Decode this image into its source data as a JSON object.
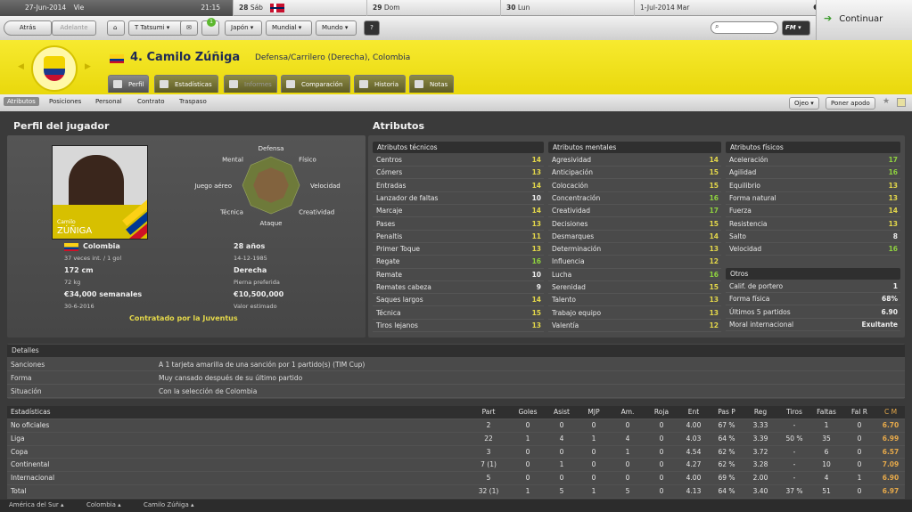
{
  "calendar": {
    "cells": [
      {
        "date": "27-Jun-2014",
        "day": "Vie",
        "time": "21:15"
      },
      {
        "date": "28",
        "day": "Sáb"
      },
      {
        "date": "29",
        "day": "Dom"
      },
      {
        "date": "30",
        "day": "Lun"
      },
      {
        "date": "1-Jul-2014",
        "day": "Mar"
      }
    ]
  },
  "toolbar": {
    "back": "Atrás",
    "forward": "Adelante",
    "manager": "T Tatsumi",
    "notif_count": "1",
    "menus": [
      "Japón",
      "Mundial",
      "Mundo"
    ],
    "help": "?",
    "fm": "FM",
    "continue": "Continuar"
  },
  "player": {
    "title": "4. Camilo Zúñiga",
    "position": "Defensa/Carrilero (Derecha), Colombia",
    "photo_caption_small": "Camilo",
    "photo_caption_big": "ZÚÑIGA",
    "nation": "Colombia",
    "caps": "37 veces int. / 1 gol",
    "age": "28 años",
    "dob": "14-12-1985",
    "height": "172 cm",
    "weight": "72 kg",
    "foot": "Derecha",
    "foot_label": "Pierna preferida",
    "wage": "€34,000 semanales",
    "contract_end": "30-6-2016",
    "value": "€10,500,000",
    "value_label": "Valor estimado",
    "contract_note": "Contratado por la Juventus"
  },
  "tabs": [
    "Perfil",
    "Estadísticas",
    "Informes",
    "Comparación",
    "Historia",
    "Notas"
  ],
  "subnav": {
    "items": [
      "Atributos",
      "Posiciones",
      "Personal",
      "Contrato",
      "Traspaso"
    ],
    "scout": "Ojeo",
    "ponder": "Poner apodo"
  },
  "sections": {
    "profile": "Perfil del jugador",
    "attributes": "Atributos"
  },
  "radar": {
    "labels": [
      "Defensa",
      "Físico",
      "Velocidad",
      "Creatividad",
      "Ataque",
      "Técnica",
      "Juego aéreo",
      "Mental"
    ]
  },
  "technical": {
    "title": "Atributos técnicos",
    "rows": [
      [
        "Centros",
        "14"
      ],
      [
        "Córners",
        "13"
      ],
      [
        "Entradas",
        "14"
      ],
      [
        "Lanzador de faltas",
        "10"
      ],
      [
        "Marcaje",
        "14"
      ],
      [
        "Pases",
        "13"
      ],
      [
        "Penaltis",
        "11"
      ],
      [
        "Primer Toque",
        "13"
      ],
      [
        "Regate",
        "16"
      ],
      [
        "Remate",
        "10"
      ],
      [
        "Remates cabeza",
        "9"
      ],
      [
        "Saques largos",
        "14"
      ],
      [
        "Técnica",
        "15"
      ],
      [
        "Tiros lejanos",
        "13"
      ]
    ]
  },
  "mental": {
    "title": "Atributos mentales",
    "rows": [
      [
        "Agresividad",
        "14"
      ],
      [
        "Anticipación",
        "15"
      ],
      [
        "Colocación",
        "15"
      ],
      [
        "Concentración",
        "16"
      ],
      [
        "Creatividad",
        "17"
      ],
      [
        "Decisiones",
        "15"
      ],
      [
        "Desmarques",
        "14"
      ],
      [
        "Determinación",
        "13"
      ],
      [
        "Influencia",
        "12"
      ],
      [
        "Lucha",
        "16"
      ],
      [
        "Serenidad",
        "15"
      ],
      [
        "Talento",
        "13"
      ],
      [
        "Trabajo equipo",
        "13"
      ],
      [
        "Valentía",
        "12"
      ]
    ]
  },
  "physical": {
    "title": "Atributos físicos",
    "rows": [
      [
        "Aceleración",
        "17"
      ],
      [
        "Agilidad",
        "16"
      ],
      [
        "Equilibrio",
        "13"
      ],
      [
        "Forma natural",
        "13"
      ],
      [
        "Fuerza",
        "14"
      ],
      [
        "Resistencia",
        "13"
      ],
      [
        "Salto",
        "8"
      ],
      [
        "Velocidad",
        "16"
      ]
    ]
  },
  "others": {
    "title": "Otros",
    "rows": [
      [
        "Calif. de portero",
        "1"
      ],
      [
        "Forma física",
        "68%"
      ],
      [
        "Últimos 5 partidos",
        "6.90"
      ],
      [
        "Moral internacional",
        "Exultante"
      ]
    ]
  },
  "details": {
    "title": "Detalles",
    "rows": [
      [
        "Sanciones",
        "A 1 tarjeta amarilla de una sanción por 1 partido(s) (TIM Cup)"
      ],
      [
        "Forma",
        "Muy cansado después de su último partido"
      ],
      [
        "Situación",
        "Con la selección de Colombia"
      ]
    ]
  },
  "stats": {
    "headers": [
      "Estadísticas",
      "Part",
      "Goles",
      "Asist",
      "MJP",
      "Am.",
      "Roja",
      "Ent",
      "Pas P",
      "Reg",
      "Tiros",
      "Faltas",
      "Fal R",
      "C M"
    ],
    "rows": [
      [
        "No oficiales",
        "2",
        "0",
        "0",
        "0",
        "0",
        "0",
        "4.00",
        "67 %",
        "3.33",
        "-",
        "1",
        "0",
        "6.70"
      ],
      [
        "Liga",
        "22",
        "1",
        "4",
        "1",
        "4",
        "0",
        "4.03",
        "64 %",
        "3.39",
        "50 %",
        "35",
        "0",
        "6.99"
      ],
      [
        "Copa",
        "3",
        "0",
        "0",
        "0",
        "1",
        "0",
        "4.54",
        "62 %",
        "3.72",
        "-",
        "6",
        "0",
        "6.57"
      ],
      [
        "Continental",
        "7 (1)",
        "0",
        "1",
        "0",
        "0",
        "0",
        "4.27",
        "62 %",
        "3.28",
        "-",
        "10",
        "0",
        "7.09"
      ],
      [
        "Internacional",
        "5",
        "0",
        "0",
        "0",
        "0",
        "0",
        "4.00",
        "69 %",
        "2.00",
        "-",
        "4",
        "1",
        "6.90"
      ],
      [
        "Total",
        "32 (1)",
        "1",
        "5",
        "1",
        "5",
        "0",
        "4.13",
        "64 %",
        "3.40",
        "37 %",
        "51",
        "0",
        "6.97"
      ]
    ]
  },
  "breadcrumb": [
    "América del Sur",
    "Colombia",
    "Camilo Zúñiga"
  ]
}
